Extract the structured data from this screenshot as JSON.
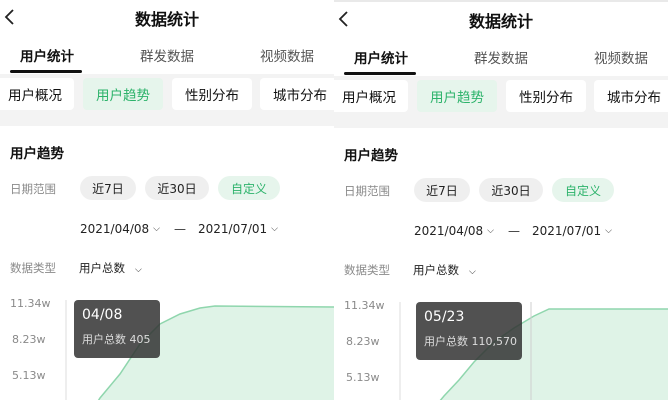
{
  "header": {
    "title": "数据统计"
  },
  "tabs": [
    "用户统计",
    "群发数据",
    "视频数据"
  ],
  "sub_tabs": [
    "用户概况",
    "用户趋势",
    "性别分布",
    "城市分布"
  ],
  "section": {
    "title": "用户趋势",
    "range_label": "日期范围",
    "range_options": [
      "近7日",
      "近30日",
      "自定义"
    ],
    "start_date": "2021/04/08",
    "end_date": "2021/07/01",
    "separator": "—",
    "type_label": "数据类型",
    "type_value": "用户总数"
  },
  "colors": {
    "accent": "#2db36b",
    "accent_bg": "#e6f5ec",
    "area_fill": "#dff3e7"
  },
  "icons": {
    "back": "chevron-left-icon",
    "dropdown": "chevron-down-icon"
  },
  "panels": [
    {
      "tooltip": {
        "date": "04/08",
        "label": "用户总数",
        "value": "405"
      }
    },
    {
      "tooltip": {
        "date": "05/23",
        "label": "用户总数",
        "value": "110,570"
      }
    }
  ],
  "chart_data": {
    "type": "area",
    "y_ticks": [
      "11.34w",
      "8.23w",
      "5.13w"
    ],
    "x": [
      "04/08",
      "05/23"
    ],
    "values": [
      405,
      110570
    ],
    "ylim": [
      0,
      113400
    ]
  }
}
